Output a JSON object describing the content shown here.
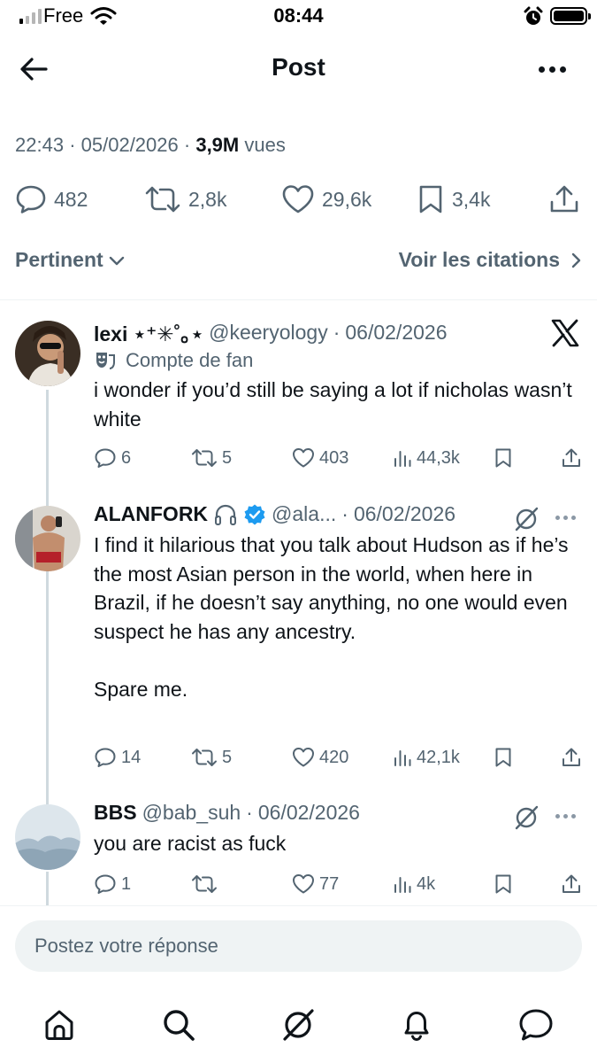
{
  "status_bar": {
    "carrier": "Free",
    "time": "08:44"
  },
  "header": {
    "title": "Post"
  },
  "post": {
    "time": "22:43",
    "date": "05/02/2026",
    "views_count": "3,9M",
    "views_label": "vues",
    "separator": "·",
    "stats": {
      "replies": "482",
      "reposts": "2,8k",
      "likes": "29,6k",
      "bookmarks": "3,4k"
    }
  },
  "sorting": {
    "left_label": "Pertinent",
    "right_label": "Voir les citations"
  },
  "replies": [
    {
      "name": "lexi ⋆⁺✳˚｡⋆",
      "handle": "@keeryology",
      "date": "06/02/2026",
      "badge": "Compte de fan",
      "text": "i wonder if you’d still be saying a lot if nicholas wasn’t white",
      "replies": "6",
      "reposts": "5",
      "likes": "403",
      "views": "44,3k"
    },
    {
      "name": "ALANFORK",
      "handle": "@ala...",
      "date": "06/02/2026",
      "text": "I find it hilarious that you talk about Hudson as if he’s the most Asian person in the world, when here in Brazil, if he doesn’t say anything, no one would even suspect he has any ancestry.\n\nSpare me.",
      "replies": "14",
      "reposts": "5",
      "likes": "420",
      "views": "42,1k"
    },
    {
      "name": "BBS",
      "handle": "@bab_suh",
      "date": "06/02/2026",
      "text": "you are racist as fuck",
      "replies": "1",
      "reposts": "",
      "likes": "77",
      "views": "4k"
    }
  ],
  "compose": {
    "placeholder": "Postez votre réponse"
  },
  "colors": {
    "text": "#0f1419",
    "muted": "#536471",
    "verified": "#1d9bf0",
    "divider": "#eff3f4"
  },
  "icons": {
    "back": "arrow-left-icon",
    "more": "more-horizontal-icon",
    "reply": "speech-bubble-icon",
    "repost": "repost-arrows-icon",
    "like": "heart-icon",
    "bookmark": "bookmark-icon",
    "share": "share-upload-icon",
    "views": "bar-chart-icon",
    "home": "home-icon",
    "search": "search-icon",
    "grok": "grok-icon",
    "notifications": "bell-icon",
    "messages": "message-icon"
  }
}
